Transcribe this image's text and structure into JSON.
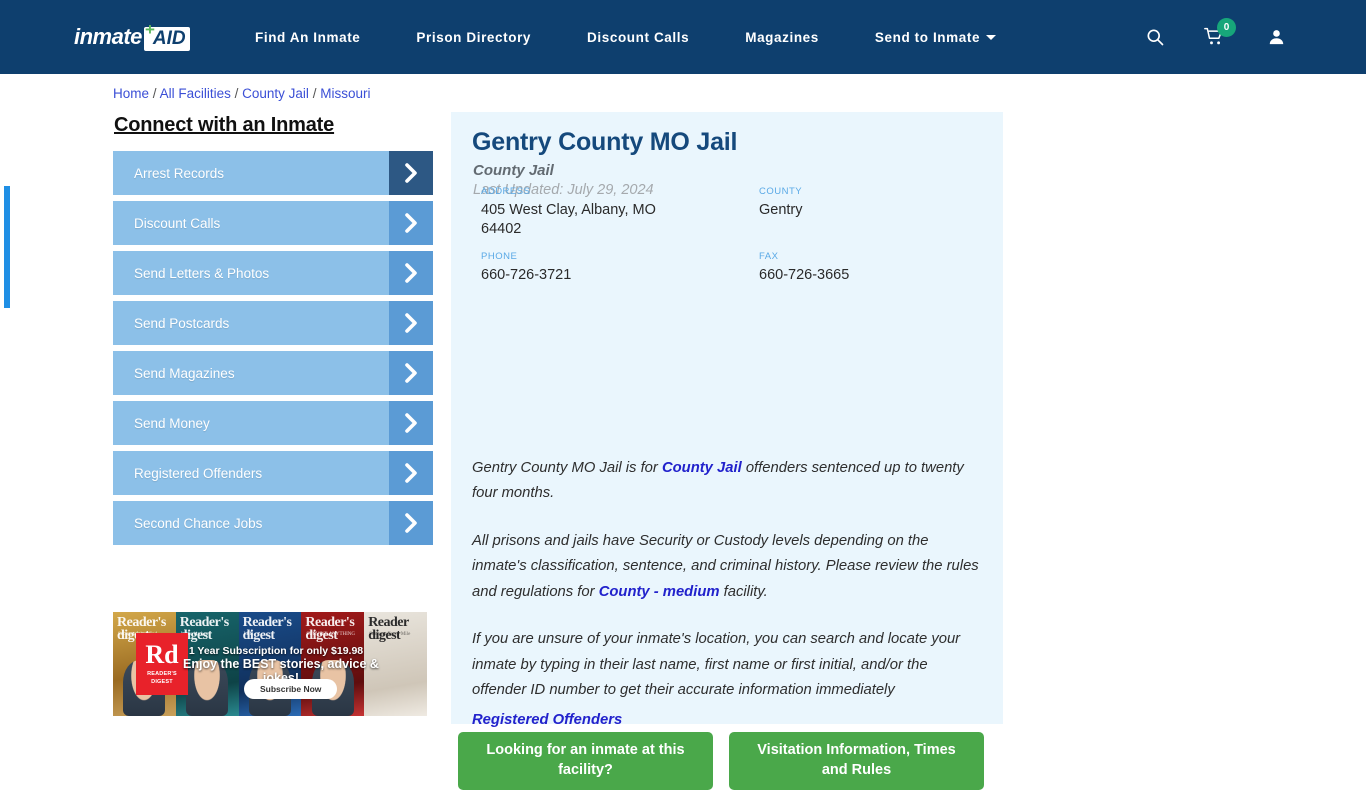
{
  "header": {
    "logo": {
      "word": "inmate",
      "plus": "+",
      "aid": "AID"
    },
    "nav": [
      {
        "label": "Find An Inmate"
      },
      {
        "label": "Prison Directory"
      },
      {
        "label": "Discount Calls"
      },
      {
        "label": "Magazines"
      },
      {
        "label": "Send to Inmate"
      }
    ],
    "icons": {
      "search": "search-icon",
      "cart": "cart-icon",
      "cart_count": "0",
      "user": "user-icon"
    },
    "colors": {
      "bar": "#0e3f6e",
      "badge": "#17a67a",
      "plus": "#5cb85c"
    }
  },
  "breadcrumb": {
    "items": [
      "Home",
      "All Facilities",
      "County Jail",
      "Missouri"
    ],
    "separator": "/"
  },
  "sidebar": {
    "title": "Connect with an Inmate",
    "items": [
      {
        "label": "Arrest Records"
      },
      {
        "label": "Discount Calls"
      },
      {
        "label": "Send Letters & Photos"
      },
      {
        "label": "Send Postcards"
      },
      {
        "label": "Send Magazines"
      },
      {
        "label": "Send Money"
      },
      {
        "label": "Registered Offenders"
      },
      {
        "label": "Second Chance Jobs"
      }
    ]
  },
  "ad": {
    "brand": "Reader's digest",
    "logo_big": "Rd",
    "logo_small": "READER'S DIGEST",
    "line1": "1 Year Subscription for only $19.98",
    "line2": "Enjoy the BEST stories, advice & jokes!",
    "cta": "Subscribe Now",
    "covers": [
      {
        "title": "Reader's digest",
        "sub": "Secrets of the Mind"
      },
      {
        "title": "Reader's digest",
        "sub": "In the kitchen"
      },
      {
        "title": "Reader's digest",
        "sub": "LEE"
      },
      {
        "title": "Reader's digest",
        "sub": "SURVIVE ANYTHING"
      },
      {
        "title": "Reader digest",
        "sub": "Stronger Every Mile"
      }
    ]
  },
  "facility": {
    "title": "Gentry County MO Jail",
    "subtitle": "County Jail",
    "last_updated": "Last Updated: July 29, 2024",
    "info": {
      "address_label": "ADDRESS",
      "address_value": "405 West Clay, Albany, MO 64402",
      "county_label": "COUNTY",
      "county_value": "Gentry",
      "phone_label": "PHONE",
      "phone_value": "660-726-3721",
      "fax_label": "FAX",
      "fax_value": "660-726-3665"
    },
    "paragraphs": {
      "p1_a": "Gentry County MO Jail is for ",
      "p1_link": "County Jail",
      "p1_b": " offenders sentenced up to twenty four months.",
      "p2_a": "All prisons and jails have Security or Custody levels depending on the inmate's classification, sentence, and criminal history. Please review the rules and regulations for ",
      "p2_link": "County - medium",
      "p2_b": " facility.",
      "p3": "If you are unsure of your inmate's location, you can search and locate your inmate by typing in their last name, first name or first initial, and/or the offender ID number to get their accurate information immediately",
      "p3_link": "Registered Offenders"
    }
  },
  "cta_buttons": [
    {
      "label": "Looking for an inmate at this facility?"
    },
    {
      "label": "Visitation Information, Times and Rules"
    }
  ],
  "colors": {
    "card_bg": "#eaf6fd",
    "accent_bar": "#1f8fe5",
    "title": "#15497c",
    "green_button": "#4aa84a",
    "sidebar_button": "#8cc0e8",
    "sidebar_chevron": "#5b9bd5",
    "sidebar_chevron_active": "#2d5884",
    "link": "#2222cc"
  }
}
